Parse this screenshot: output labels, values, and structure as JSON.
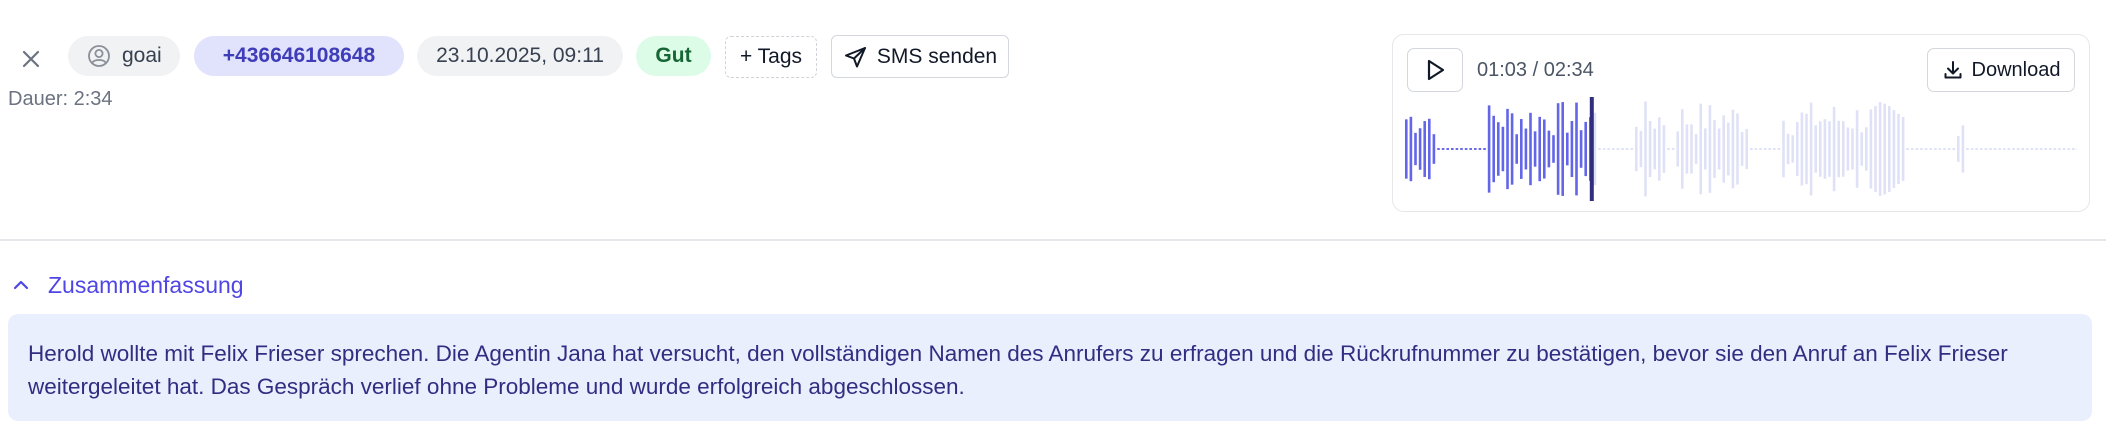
{
  "header": {
    "user_label": "goai",
    "phone": "+436646108648",
    "datetime": "23.10.2025, 09:11",
    "rating": "Gut",
    "tags_label": "+ Tags",
    "sms_label": "SMS senden",
    "duration": "Dauer: 2:34"
  },
  "player": {
    "time_display": "01:03 / 02:34",
    "download_label": "Download",
    "current_seconds": 63,
    "total_seconds": 154,
    "played_color": "#6466e9",
    "unplayed_color": "#dfe2f7",
    "playhead_color": "#312e81"
  },
  "summary": {
    "title": "Zusammenfassung",
    "text": "Herold wollte mit Felix Frieser sprechen. Die Agentin Jana hat versucht, den vollständigen Namen des Anrufers zu erfragen und die Rückrufnummer zu bestätigen, bevor sie den Anruf an Felix Frieser weitergeleitet hat. Das Gespräch verlief ohne Probleme und wurde erfolgreich abgeschlossen."
  },
  "icons": {
    "close": "close-icon",
    "user": "user-circle-icon",
    "send": "paper-plane-icon",
    "play": "play-icon",
    "download": "download-icon",
    "collapse": "chevron-up-icon"
  }
}
